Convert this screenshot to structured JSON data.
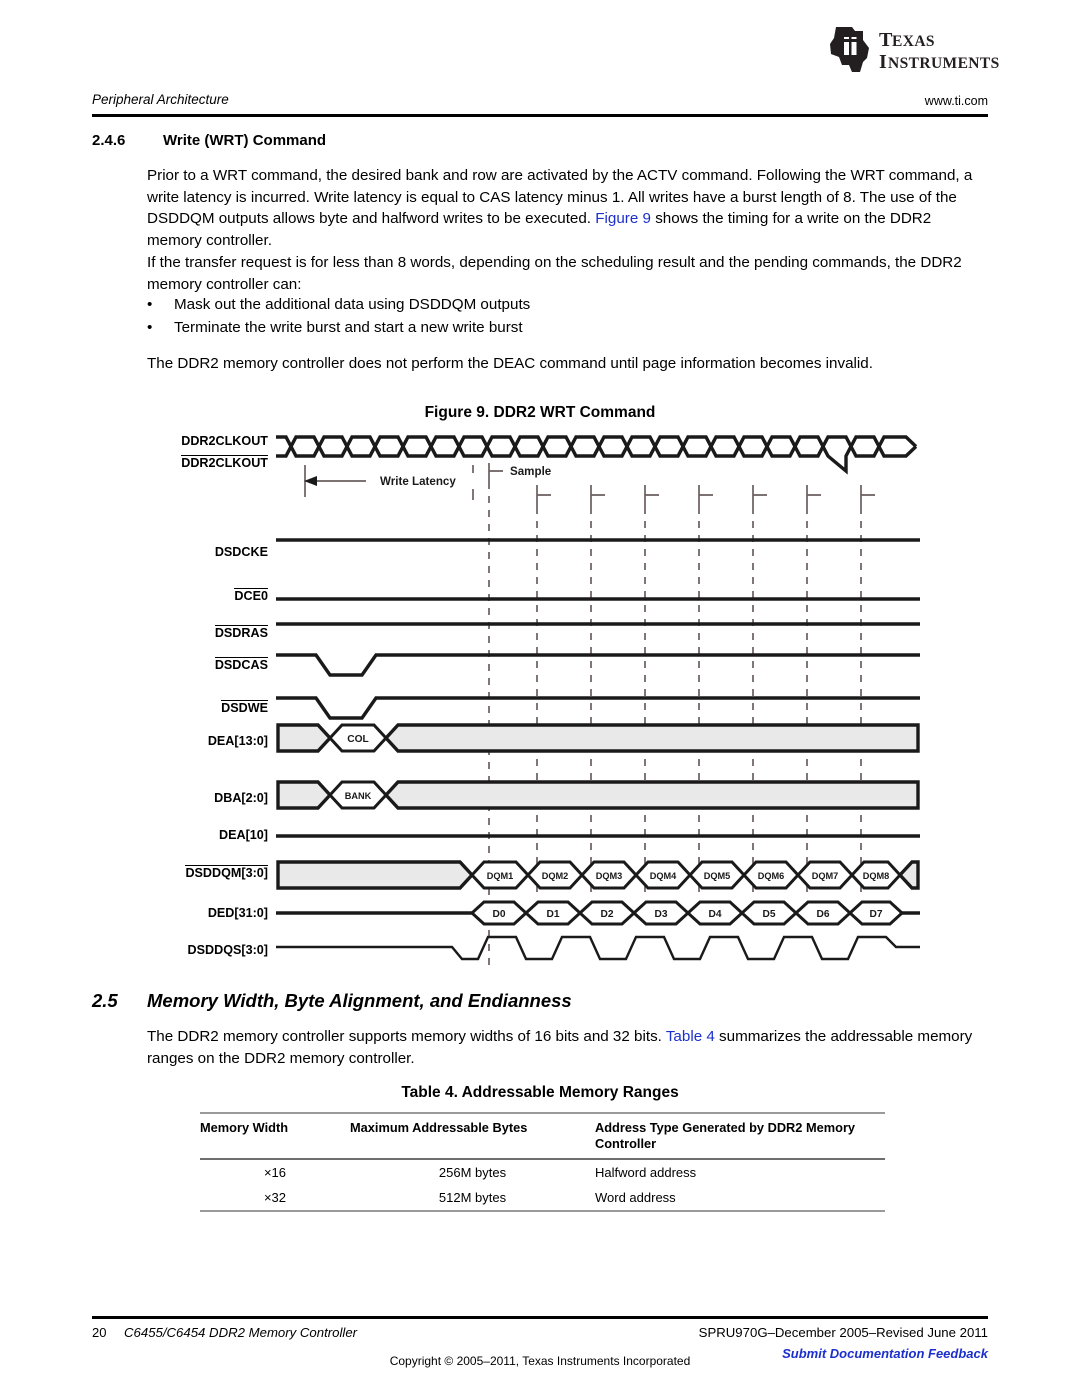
{
  "header": {
    "logo_alt": "texas-instruments-logo",
    "logo_line1": "TEXAS",
    "logo_line2": "INSTRUMENTS",
    "running_head": "Peripheral Architecture",
    "url": "www.ti.com"
  },
  "section_246": {
    "number": "2.4.6",
    "title": "Write (WRT) Command",
    "paragraph1_a": "Prior to a WRT command, the desired bank and row are activated by the ACTV command. Following the WRT command, a write latency is incurred. Write latency is equal to CAS latency minus 1. All writes have a burst length of 8. The use of the DSDDQM outputs allows byte and halfword writes to be executed. ",
    "paragraph1_link": "Figure 9",
    "paragraph1_b": " shows the timing for a write on the DDR2 memory controller.",
    "paragraph2": "If the transfer request is for less than 8 words, depending on the scheduling result and the pending commands, the DDR2 memory controller can:",
    "bullet_marker": "•",
    "bullets": [
      "Mask out the additional data using DSDDQM outputs",
      "Terminate the write burst and start a new write burst"
    ],
    "paragraph3": "The DDR2 memory controller does not perform the DEAC command until page information becomes invalid."
  },
  "figure": {
    "title": "Figure 9. DDR2 WRT Command",
    "annotations": {
      "write_latency": "Write Latency",
      "sample": "Sample"
    },
    "signals": [
      {
        "label": "DDR2CLKOUT",
        "overbar": false,
        "kind": "clock-true"
      },
      {
        "label": "DDR2CLKOUT",
        "overbar": true,
        "kind": "clock-comp"
      },
      {
        "label": "DSDCKE",
        "overbar": false,
        "kind": "level-high"
      },
      {
        "label": "DCE0",
        "overbar": true,
        "kind": "level-low"
      },
      {
        "label": "DSDRAS",
        "overbar": true,
        "kind": "level-high"
      },
      {
        "label": "DSDCAS",
        "overbar": true,
        "kind": "pulse-low"
      },
      {
        "label": "DSDWE",
        "overbar": true,
        "kind": "pulse-low"
      },
      {
        "label": "DEA[13:0]",
        "overbar": false,
        "kind": "bus-single",
        "value": "COL"
      },
      {
        "label": "DBA[2:0]",
        "overbar": false,
        "kind": "bus-single",
        "value": "BANK"
      },
      {
        "label": "DEA[10]",
        "overbar": false,
        "kind": "level-low"
      },
      {
        "label": "DSDDQM[3:0]",
        "overbar": true,
        "kind": "bus-burst",
        "values": [
          "DQM1",
          "DQM2",
          "DQM3",
          "DQM4",
          "DQM5",
          "DQM6",
          "DQM7",
          "DQM8"
        ]
      },
      {
        "label": "DED[31:0]",
        "overbar": false,
        "kind": "data-burst",
        "values": [
          "D0",
          "D1",
          "D2",
          "D3",
          "D4",
          "D5",
          "D6",
          "D7"
        ]
      },
      {
        "label": "DSDDQS[3:0]",
        "overbar": false,
        "kind": "strobe"
      }
    ],
    "colors": {
      "wave": "#1a1a1a",
      "bus_fill": "#e9e9e9",
      "grid_dash": "#6b5f5f"
    }
  },
  "section_25": {
    "number": "2.5",
    "title": "Memory Width, Byte Alignment, and Endianness",
    "paragraph_a": "The DDR2 memory controller supports memory widths of 16 bits and 32 bits. ",
    "paragraph_link": "Table 4",
    "paragraph_b": " summarizes the addressable memory ranges on the DDR2 memory controller."
  },
  "table4": {
    "title": "Table 4. Addressable Memory Ranges",
    "columns": [
      "Memory Width",
      "Maximum Addressable Bytes",
      "Address Type Generated by DDR2 Memory Controller"
    ],
    "rows": [
      [
        "×16",
        "256M bytes",
        "Halfword address"
      ],
      [
        "×32",
        "512M bytes",
        "Word address"
      ]
    ]
  },
  "footer": {
    "page": "20",
    "document": "C6455/C6454 DDR2 Memory Controller",
    "revision": "SPRU970G–December 2005–Revised June 2011",
    "feedback": "Submit Documentation Feedback",
    "copyright": "Copyright © 2005–2011, Texas Instruments Incorporated",
    "link_color": "#1b2fcc"
  }
}
